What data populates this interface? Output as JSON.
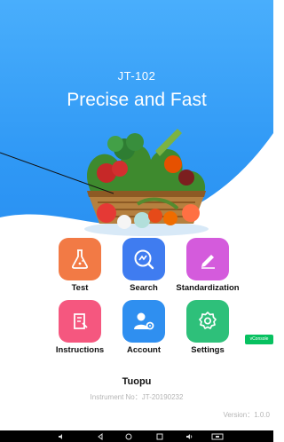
{
  "header": {
    "model": "JT-102",
    "slogan": "Precise and Fast"
  },
  "menu": [
    {
      "label": "Test",
      "icon": "flask-icon",
      "color": "#f27a45"
    },
    {
      "label": "Search",
      "icon": "search-chart-icon",
      "color": "#3f7cf0"
    },
    {
      "label": "Standardization",
      "icon": "pencil-icon",
      "color": "#d45bdc"
    },
    {
      "label": "Instructions",
      "icon": "book-icon",
      "color": "#f5577f"
    },
    {
      "label": "Account",
      "icon": "user-gear-icon",
      "color": "#2f8ff0"
    },
    {
      "label": "Settings",
      "icon": "gear-icon",
      "color": "#2ec07a"
    }
  ],
  "vconsole": "vConsole",
  "footer": {
    "company": "Tuopu",
    "instrument": "Instrument No：JT-20190232",
    "version": "Version：1.0.0"
  },
  "navbar": {
    "buttons": [
      "volume-down-icon",
      "back-icon",
      "home-icon",
      "recents-icon",
      "volume-up-icon",
      "screenshot-icon"
    ]
  }
}
